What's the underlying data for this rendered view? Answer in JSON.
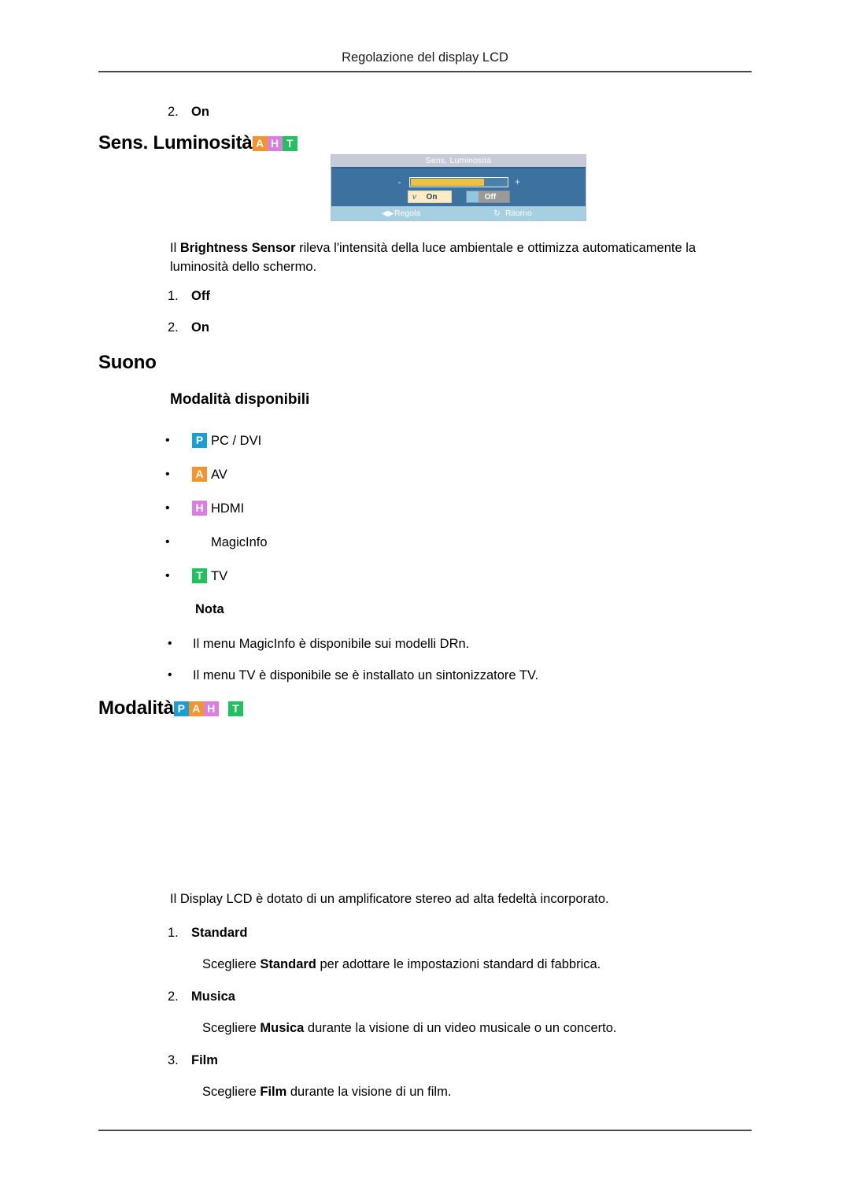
{
  "header": {
    "title": "Regolazione del display LCD"
  },
  "top_item": {
    "num": "2.",
    "label": "On"
  },
  "section_brightness": {
    "heading": "Sens. Luminosità",
    "badges": [
      {
        "letter": "A",
        "color": "#f5932f",
        "name": "badge-av"
      },
      {
        "letter": "H",
        "color": "#da7ee0",
        "name": "badge-hdmi"
      },
      {
        "letter": "T",
        "color": "#22c05e",
        "name": "badge-tv"
      }
    ],
    "paragraph_pre": "Il ",
    "paragraph_bold": "Brightness Sensor",
    "paragraph_post": " rileva l'intensità della luce ambientale e ottimizza automaticamente la luminosità dello schermo.",
    "items": [
      {
        "num": "1.",
        "label": "Off"
      },
      {
        "num": "2.",
        "label": "On"
      }
    ]
  },
  "osd": {
    "title": "Sens. Luminosità",
    "minus": "-",
    "plus": "+",
    "bar_fill_percent": 77,
    "button_on": {
      "check": "v",
      "label": "On"
    },
    "button_off": {
      "label": "Off"
    },
    "footer_left": {
      "icon": "adjust-arrows-icon",
      "glyph": "◀▶",
      "label": "Regola"
    },
    "footer_right": {
      "icon": "return-circle-icon",
      "glyph": "↻",
      "label": "Ritorno"
    },
    "colors": {
      "body": "#3d72a0",
      "title_bar": "#c6cbd7",
      "footer": "#a6cfe2",
      "bar_fill": "#f0c040"
    }
  },
  "section_sound": {
    "heading": "Suono",
    "sub_heading": "Modalità disponibili",
    "modes": [
      {
        "badge": "P",
        "color": "#1a9ed4",
        "label": "PC / DVI",
        "name": "mode-pc-dvi"
      },
      {
        "badge": "A",
        "color": "#f5932f",
        "label": "AV",
        "name": "mode-av"
      },
      {
        "badge": "H",
        "color": "#da7ee0",
        "label": "HDMI",
        "name": "mode-hdmi"
      },
      {
        "badge": "",
        "color": "",
        "label": "MagicInfo",
        "name": "mode-magicinfo"
      },
      {
        "badge": "T",
        "color": "#22c05e",
        "label": "TV",
        "name": "mode-tv"
      }
    ],
    "note_title": "Nota",
    "notes": [
      "Il menu MagicInfo è disponibile sui modelli DRn.",
      "Il menu TV è disponibile se è installato un sintonizzatore TV."
    ]
  },
  "section_modalita": {
    "heading": "Modalità",
    "badges": [
      {
        "letter": "P",
        "color": "#1a9ed4",
        "name": "badge-pc"
      },
      {
        "letter": "A",
        "color": "#f5932f",
        "name": "badge-av"
      },
      {
        "letter": "H",
        "color": "#da7ee0",
        "name": "badge-hdmi"
      }
    ],
    "badge_trailing": {
      "letter": "T",
      "color": "#22c05e",
      "name": "badge-tv"
    },
    "intro": "Il Display LCD è dotato di un amplificatore stereo ad alta fedeltà incorporato.",
    "items": [
      {
        "num": "1.",
        "label": "Standard",
        "desc_pre": "Scegliere ",
        "desc_bold": "Standard",
        "desc_post": " per adottare le impostazioni standard di fabbrica."
      },
      {
        "num": "2.",
        "label": "Musica",
        "desc_pre": "Scegliere ",
        "desc_bold": "Musica",
        "desc_post": " durante la visione di un video musicale o un concerto."
      },
      {
        "num": "3.",
        "label": "Film",
        "desc_pre": "Scegliere ",
        "desc_bold": "Film",
        "desc_post": " durante la visione di un film."
      }
    ]
  },
  "bullet_glyph": "•"
}
